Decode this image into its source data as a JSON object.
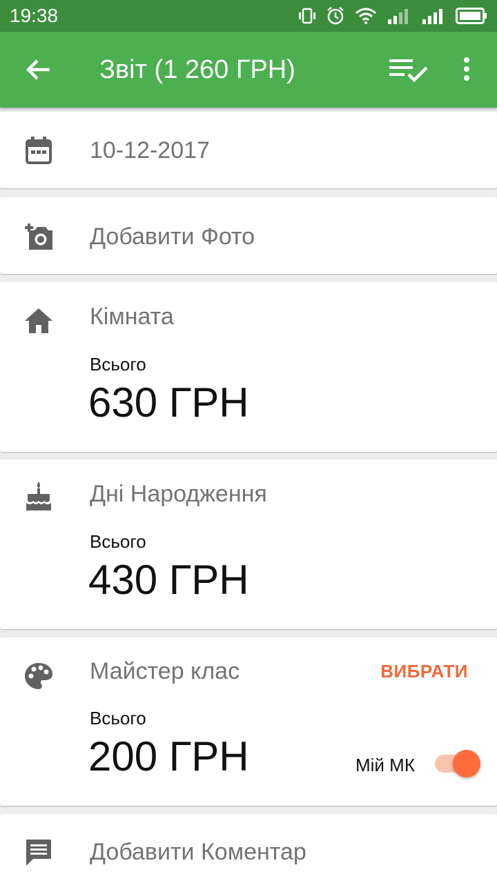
{
  "status_bar": {
    "time": "19:38",
    "icons": [
      "vibrate-icon",
      "alarm-icon",
      "wifi-icon",
      "signal-3g-icon",
      "signal-icon",
      "battery-icon"
    ]
  },
  "app_bar": {
    "title": "Звіт (1 260 ГРН)",
    "color": "#4caf50",
    "icons": [
      "back-arrow-icon",
      "checklist-icon",
      "more-vert-icon"
    ]
  },
  "date_row": {
    "icon": "calendar-icon",
    "value": "10-12-2017"
  },
  "photo_row": {
    "icon": "add-photo-icon",
    "label": "Добавити Фото"
  },
  "room_card": {
    "icon": "home-icon",
    "title": "Кімната",
    "total_label": "Всього",
    "total_value": "630 ГРН"
  },
  "birthday_card": {
    "icon": "cake-icon",
    "title": "Дні Народження",
    "total_label": "Всього",
    "total_value": "430 ГРН"
  },
  "masterclass_card": {
    "icon": "palette-icon",
    "title": "Майстер клас",
    "choose_label": "ВИБРАТИ",
    "total_label": "Всього",
    "total_value": "200 ГРН",
    "toggle_label": "Мій МК",
    "toggle_on": true,
    "accent": "#ff6b3a"
  },
  "comment_row": {
    "icon": "comment-icon",
    "label": "Добавити Коментар"
  }
}
